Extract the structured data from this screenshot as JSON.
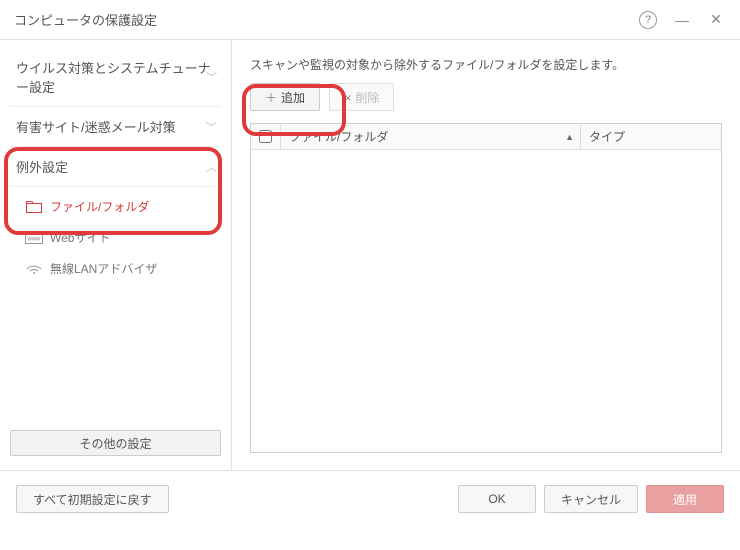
{
  "window": {
    "title": "コンピュータの保護設定"
  },
  "sidebar": {
    "groups": [
      {
        "label": "ウイルス対策とシステムチューナー設定"
      },
      {
        "label": "有害サイト/迷惑メール対策"
      },
      {
        "label": "例外設定"
      }
    ],
    "sub_items": [
      {
        "label": "ファイル/フォルダ"
      },
      {
        "label": "Webサイト"
      },
      {
        "label": "無線LANアドバイザ"
      }
    ],
    "other_settings": "その他の設定"
  },
  "main": {
    "description": "スキャンや監視の対象から除外するファイル/フォルダを設定します。",
    "toolbar": {
      "add": "追加",
      "delete": "削除"
    },
    "table": {
      "columns": {
        "file": "ファイル/フォルダ",
        "type": "タイプ"
      },
      "rows": []
    }
  },
  "footer": {
    "reset": "すべて初期設定に戻す",
    "ok": "OK",
    "cancel": "キャンセル",
    "apply": "適用"
  }
}
